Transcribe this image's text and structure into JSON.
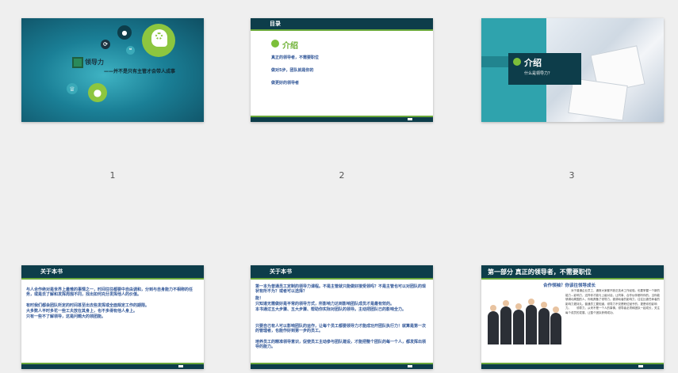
{
  "slides": [
    {
      "number": "1",
      "title": "领导力",
      "subtitle": "——并不是只有主管才会带人成事"
    },
    {
      "number": "2",
      "header": "目录",
      "heading": "介绍",
      "items": [
        "真正的领导者，不需要职位",
        "做对5步，团队就是你的",
        "做更好的领导者"
      ]
    },
    {
      "number": "3",
      "heading": "介绍",
      "subheading": "什么是领导力？"
    },
    {
      "number": "4",
      "header": "关于本书",
      "paragraphs": [
        "与人合作绝对是世界上最难的事情之一，时间往往都要中自由调和，分到与自身能力不相称的任务，或是去了解和发挥周围不同，找出如何充分发挥他人的价值。",
        "有时我们都会团队所定的时间甚至出去些发挥或全面规定工作的期限。",
        "大多数人平时多花一些工夫放在其身上，也不多得有他人身上。",
        "只有一些不了解领导，这是问题大的领团能。"
      ]
    },
    {
      "number": "5",
      "header": "关于本书",
      "paragraphs": [
        "第一本为普通员工定制的领导力课程。不是主管就只能做好接受领吗？不是主管也可以对团队的现状有所不为？或者可以选择？",
        "能！",
        "只知道无需做好是平常的领导方式，所影响力达到影响团队成员才是最有效的。",
        "本书通过五大步骤、五大步骤、帮助你实际对团队的领导。主动把团队已的影响全力。",
        "只要自己有人可以影响团队的运作，让每个员工都要领导力才能成功开团队执行力！就算是第一次的管理者，也能作好到第一步的员工。",
        "培养员工的精准领导意识，促使员工主动参与团队建设，才能把整个团队的每一个人，都发挥出领导的能力。"
      ]
    },
    {
      "number": "6",
      "header": "第一部分 真正的领导者，不需要职位",
      "subheading": "合作领袖？你该往领导成长",
      "text": "　　对于普通企业员工，通常大家都不缺乏技术工作经验。也要掌握一个新的能力—影响力，这样你才能与上级对话，让同事、合作伙伴都听你的。当你能够调动周围的人，你就具备了领导力。被调动者的影响力，往往比被任命者的影响力更持久。普通员工要知道，领导力不仅是职位赋予的，更是你的影响力。　　领导力，从来不是一个人的事情，领导者必须和团队一起成长，关注每个成员的发展，让整个团队获得成功。"
    }
  ]
}
